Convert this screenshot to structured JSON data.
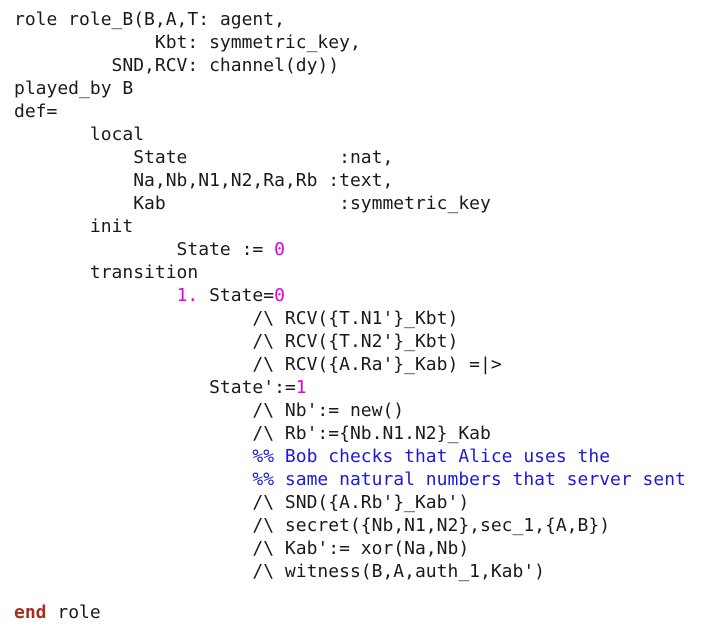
{
  "editor": {
    "lines": [
      "role role_B(B,A,T: agent,",
      "             Kbt: symmetric_key,",
      "         SND,RCV: channel(dy))",
      "played_by B",
      "def=",
      "       local",
      "           State              :nat,",
      "           Na,Nb,N1,N2,Ra,Rb :text,",
      "           Kab                :symmetric_key",
      "       init",
      "               State := ",
      "       transition",
      "               ",
      "                      /\\ RCV({T.N1'}_Kbt)",
      "                      /\\ RCV({T.N2'}_Kbt)",
      "                      /\\ RCV({A.Ra'}_Kab) =|>",
      "                  State':=",
      "                      /\\ Nb':= new()",
      "                      /\\ Rb':={Nb.N1.N2}_Kab",
      "                      %% Bob checks that Alice uses the",
      "                      %% same natural numbers that server sent",
      "                      /\\ SND({A.Rb'}_Kab')",
      "                      /\\ secret({Nb,N1,N2},sec_1,{A,B})",
      "                      /\\ Kab':= xor(Na,Nb)",
      "                      /\\ witness(B,A,auth_1,Kab')",
      "",
      "end role"
    ],
    "init_state_value": "0",
    "transition_step_label": "1.",
    "transition_guard_text": " State=",
    "transition_guard_value": "0",
    "new_state_value": "1",
    "end_keyword": "end",
    "end_suffix": " role",
    "colors": {
      "text": "#1a1a1a",
      "keyword": "#a0321e",
      "number": "#e000e0",
      "comment": "#1a1ad8",
      "background": "#ffffff"
    }
  }
}
